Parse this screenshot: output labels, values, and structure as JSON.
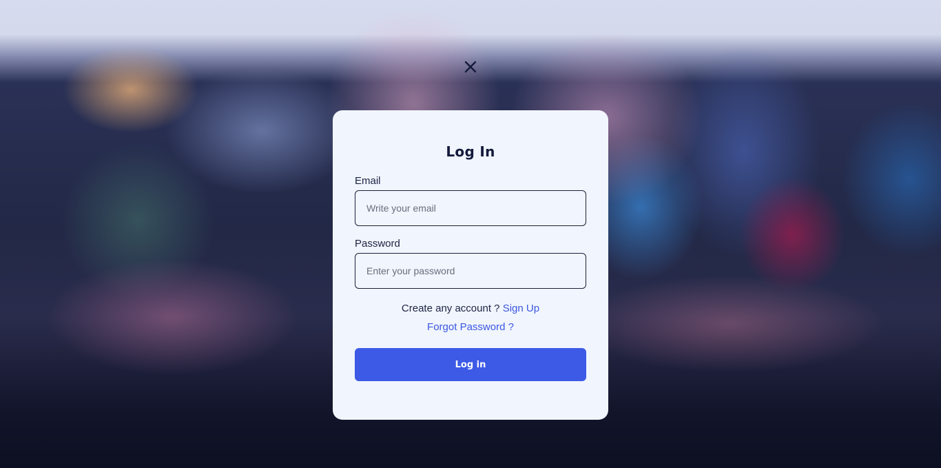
{
  "modal": {
    "title": "Log In",
    "close_icon": "close-icon",
    "email": {
      "label": "Email",
      "placeholder": "Write your email",
      "value": ""
    },
    "password": {
      "label": "Password",
      "placeholder": "Enter your password",
      "value": ""
    },
    "signup_prompt": "Create any account ?",
    "signup_link": "Sign Up",
    "forgot_link": "Forgot Password ?",
    "login_button": "Log in"
  },
  "colors": {
    "modal_bg": "#f1f5fd",
    "text_dark": "#141a3c",
    "link": "#3a57e0",
    "button": "#3d5ae6"
  }
}
